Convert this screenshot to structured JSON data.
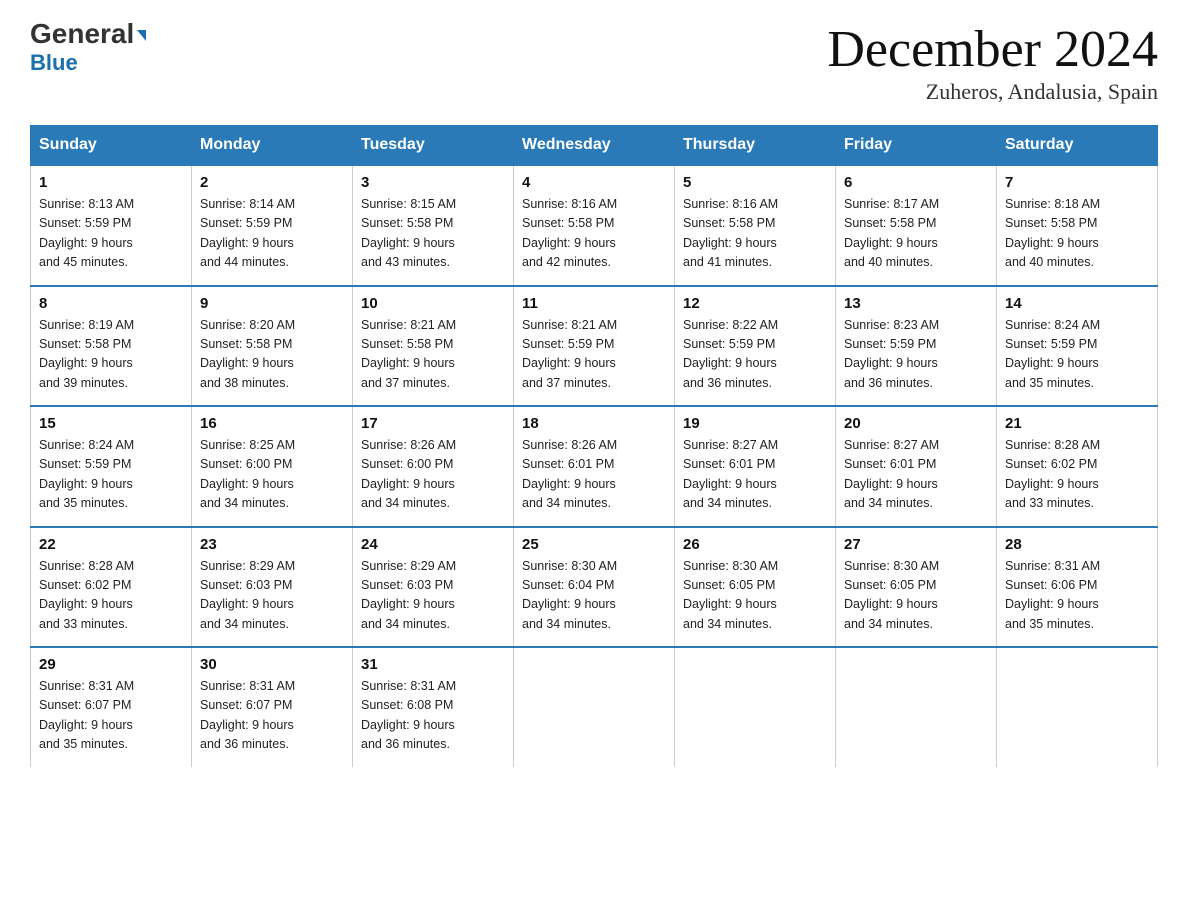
{
  "logo": {
    "general": "General",
    "arrow": "▶",
    "blue": "Blue"
  },
  "title": "December 2024",
  "location": "Zuheros, Andalusia, Spain",
  "days_of_week": [
    "Sunday",
    "Monday",
    "Tuesday",
    "Wednesday",
    "Thursday",
    "Friday",
    "Saturday"
  ],
  "weeks": [
    [
      {
        "day": "1",
        "sunrise": "8:13 AM",
        "sunset": "5:59 PM",
        "daylight": "9 hours and 45 minutes."
      },
      {
        "day": "2",
        "sunrise": "8:14 AM",
        "sunset": "5:59 PM",
        "daylight": "9 hours and 44 minutes."
      },
      {
        "day": "3",
        "sunrise": "8:15 AM",
        "sunset": "5:58 PM",
        "daylight": "9 hours and 43 minutes."
      },
      {
        "day": "4",
        "sunrise": "8:16 AM",
        "sunset": "5:58 PM",
        "daylight": "9 hours and 42 minutes."
      },
      {
        "day": "5",
        "sunrise": "8:16 AM",
        "sunset": "5:58 PM",
        "daylight": "9 hours and 41 minutes."
      },
      {
        "day": "6",
        "sunrise": "8:17 AM",
        "sunset": "5:58 PM",
        "daylight": "9 hours and 40 minutes."
      },
      {
        "day": "7",
        "sunrise": "8:18 AM",
        "sunset": "5:58 PM",
        "daylight": "9 hours and 40 minutes."
      }
    ],
    [
      {
        "day": "8",
        "sunrise": "8:19 AM",
        "sunset": "5:58 PM",
        "daylight": "9 hours and 39 minutes."
      },
      {
        "day": "9",
        "sunrise": "8:20 AM",
        "sunset": "5:58 PM",
        "daylight": "9 hours and 38 minutes."
      },
      {
        "day": "10",
        "sunrise": "8:21 AM",
        "sunset": "5:58 PM",
        "daylight": "9 hours and 37 minutes."
      },
      {
        "day": "11",
        "sunrise": "8:21 AM",
        "sunset": "5:59 PM",
        "daylight": "9 hours and 37 minutes."
      },
      {
        "day": "12",
        "sunrise": "8:22 AM",
        "sunset": "5:59 PM",
        "daylight": "9 hours and 36 minutes."
      },
      {
        "day": "13",
        "sunrise": "8:23 AM",
        "sunset": "5:59 PM",
        "daylight": "9 hours and 36 minutes."
      },
      {
        "day": "14",
        "sunrise": "8:24 AM",
        "sunset": "5:59 PM",
        "daylight": "9 hours and 35 minutes."
      }
    ],
    [
      {
        "day": "15",
        "sunrise": "8:24 AM",
        "sunset": "5:59 PM",
        "daylight": "9 hours and 35 minutes."
      },
      {
        "day": "16",
        "sunrise": "8:25 AM",
        "sunset": "6:00 PM",
        "daylight": "9 hours and 34 minutes."
      },
      {
        "day": "17",
        "sunrise": "8:26 AM",
        "sunset": "6:00 PM",
        "daylight": "9 hours and 34 minutes."
      },
      {
        "day": "18",
        "sunrise": "8:26 AM",
        "sunset": "6:01 PM",
        "daylight": "9 hours and 34 minutes."
      },
      {
        "day": "19",
        "sunrise": "8:27 AM",
        "sunset": "6:01 PM",
        "daylight": "9 hours and 34 minutes."
      },
      {
        "day": "20",
        "sunrise": "8:27 AM",
        "sunset": "6:01 PM",
        "daylight": "9 hours and 34 minutes."
      },
      {
        "day": "21",
        "sunrise": "8:28 AM",
        "sunset": "6:02 PM",
        "daylight": "9 hours and 33 minutes."
      }
    ],
    [
      {
        "day": "22",
        "sunrise": "8:28 AM",
        "sunset": "6:02 PM",
        "daylight": "9 hours and 33 minutes."
      },
      {
        "day": "23",
        "sunrise": "8:29 AM",
        "sunset": "6:03 PM",
        "daylight": "9 hours and 34 minutes."
      },
      {
        "day": "24",
        "sunrise": "8:29 AM",
        "sunset": "6:03 PM",
        "daylight": "9 hours and 34 minutes."
      },
      {
        "day": "25",
        "sunrise": "8:30 AM",
        "sunset": "6:04 PM",
        "daylight": "9 hours and 34 minutes."
      },
      {
        "day": "26",
        "sunrise": "8:30 AM",
        "sunset": "6:05 PM",
        "daylight": "9 hours and 34 minutes."
      },
      {
        "day": "27",
        "sunrise": "8:30 AM",
        "sunset": "6:05 PM",
        "daylight": "9 hours and 34 minutes."
      },
      {
        "day": "28",
        "sunrise": "8:31 AM",
        "sunset": "6:06 PM",
        "daylight": "9 hours and 35 minutes."
      }
    ],
    [
      {
        "day": "29",
        "sunrise": "8:31 AM",
        "sunset": "6:07 PM",
        "daylight": "9 hours and 35 minutes."
      },
      {
        "day": "30",
        "sunrise": "8:31 AM",
        "sunset": "6:07 PM",
        "daylight": "9 hours and 36 minutes."
      },
      {
        "day": "31",
        "sunrise": "8:31 AM",
        "sunset": "6:08 PM",
        "daylight": "9 hours and 36 minutes."
      },
      null,
      null,
      null,
      null
    ]
  ]
}
